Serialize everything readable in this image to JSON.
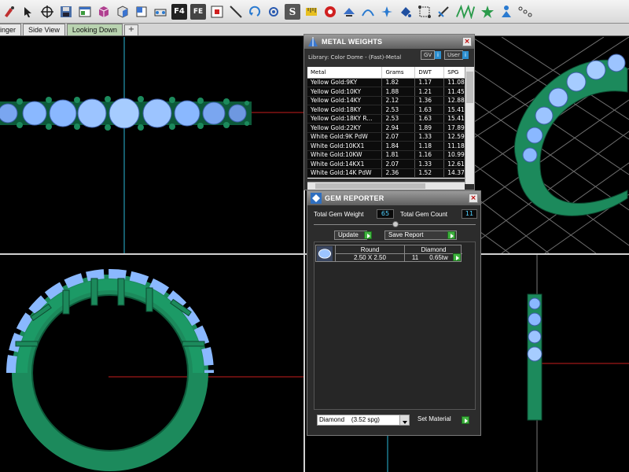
{
  "toolbar": {
    "icons": [
      "paint-icon",
      "select-icon",
      "crosshair-icon",
      "save-icon",
      "window-icon",
      "cube-front-icon",
      "cube-side-icon",
      "cube-top-icon",
      "node-icon",
      "f4-icon",
      "fe-icon",
      "grid-icon",
      "line-icon",
      "rotate-icon",
      "spin-icon",
      "s-icon",
      "ruler-icon",
      "record-icon",
      "arch-icon",
      "curve-icon",
      "sparkle-icon",
      "fill-icon",
      "transform-icon",
      "align-icon",
      "gradient-icon",
      "star-icon",
      "person-icon",
      "chain-icon"
    ],
    "f4_label": "F4",
    "fe_label": "FE",
    "s_label": "S"
  },
  "tabs": [
    {
      "label": "inger",
      "active": false
    },
    {
      "label": "Side View",
      "active": false
    },
    {
      "label": "Looking Down",
      "active": true
    }
  ],
  "tab_add": "+",
  "metal_weights": {
    "title": "METAL WEIGHTS",
    "library": "Library: Color Dome - (Fast)-Metal",
    "gv_label": "GV",
    "user_label": "User",
    "info": "i",
    "columns": [
      "Metal",
      "Grams",
      "DWT",
      "SPG"
    ],
    "rows": [
      [
        "Yellow Gold:9KY",
        "1.82",
        "1.17",
        "11.08"
      ],
      [
        "Yellow Gold:10KY",
        "1.88",
        "1.21",
        "11.45"
      ],
      [
        "Yellow Gold:14KY",
        "2.12",
        "1.36",
        "12.88"
      ],
      [
        "Yellow Gold:18KY",
        "2.53",
        "1.63",
        "15.41"
      ],
      [
        "Yellow Gold:18KY R...",
        "2.53",
        "1.63",
        "15.41"
      ],
      [
        "Yellow Gold:22KY",
        "2.94",
        "1.89",
        "17.89"
      ],
      [
        "White Gold:9K PdW",
        "2.07",
        "1.33",
        "12.59"
      ],
      [
        "White Gold:10KX1",
        "1.84",
        "1.18",
        "11.18"
      ],
      [
        "White Gold:10KW",
        "1.81",
        "1.16",
        "10.99"
      ],
      [
        "White Gold:14KX1",
        "2.07",
        "1.33",
        "12.61"
      ],
      [
        "White Gold:14K PdW",
        "2.36",
        "1.52",
        "14.37"
      ]
    ]
  },
  "gem_reporter": {
    "title": "GEM REPORTER",
    "total_weight_label": "Total Gem Weight",
    "total_weight_value": "65",
    "total_count_label": "Total Gem Count",
    "total_count_value": "11",
    "update_label": "Update",
    "save_report_label": "Save Report",
    "gem": {
      "shape": "Round",
      "material": "Diamond",
      "size": "2.50 X 2.50",
      "count": "11",
      "weight": "0.65tw"
    },
    "material_select": "Diamond    (3.52 spg)",
    "set_material_label": "Set Material"
  },
  "colors": {
    "metal_green": "#1c8a5c",
    "gem_blue": "#8ab8ff",
    "grid": "#7a7a7a",
    "axis_red": "#c81e1e",
    "axis_cyan": "#2ab8d8"
  }
}
